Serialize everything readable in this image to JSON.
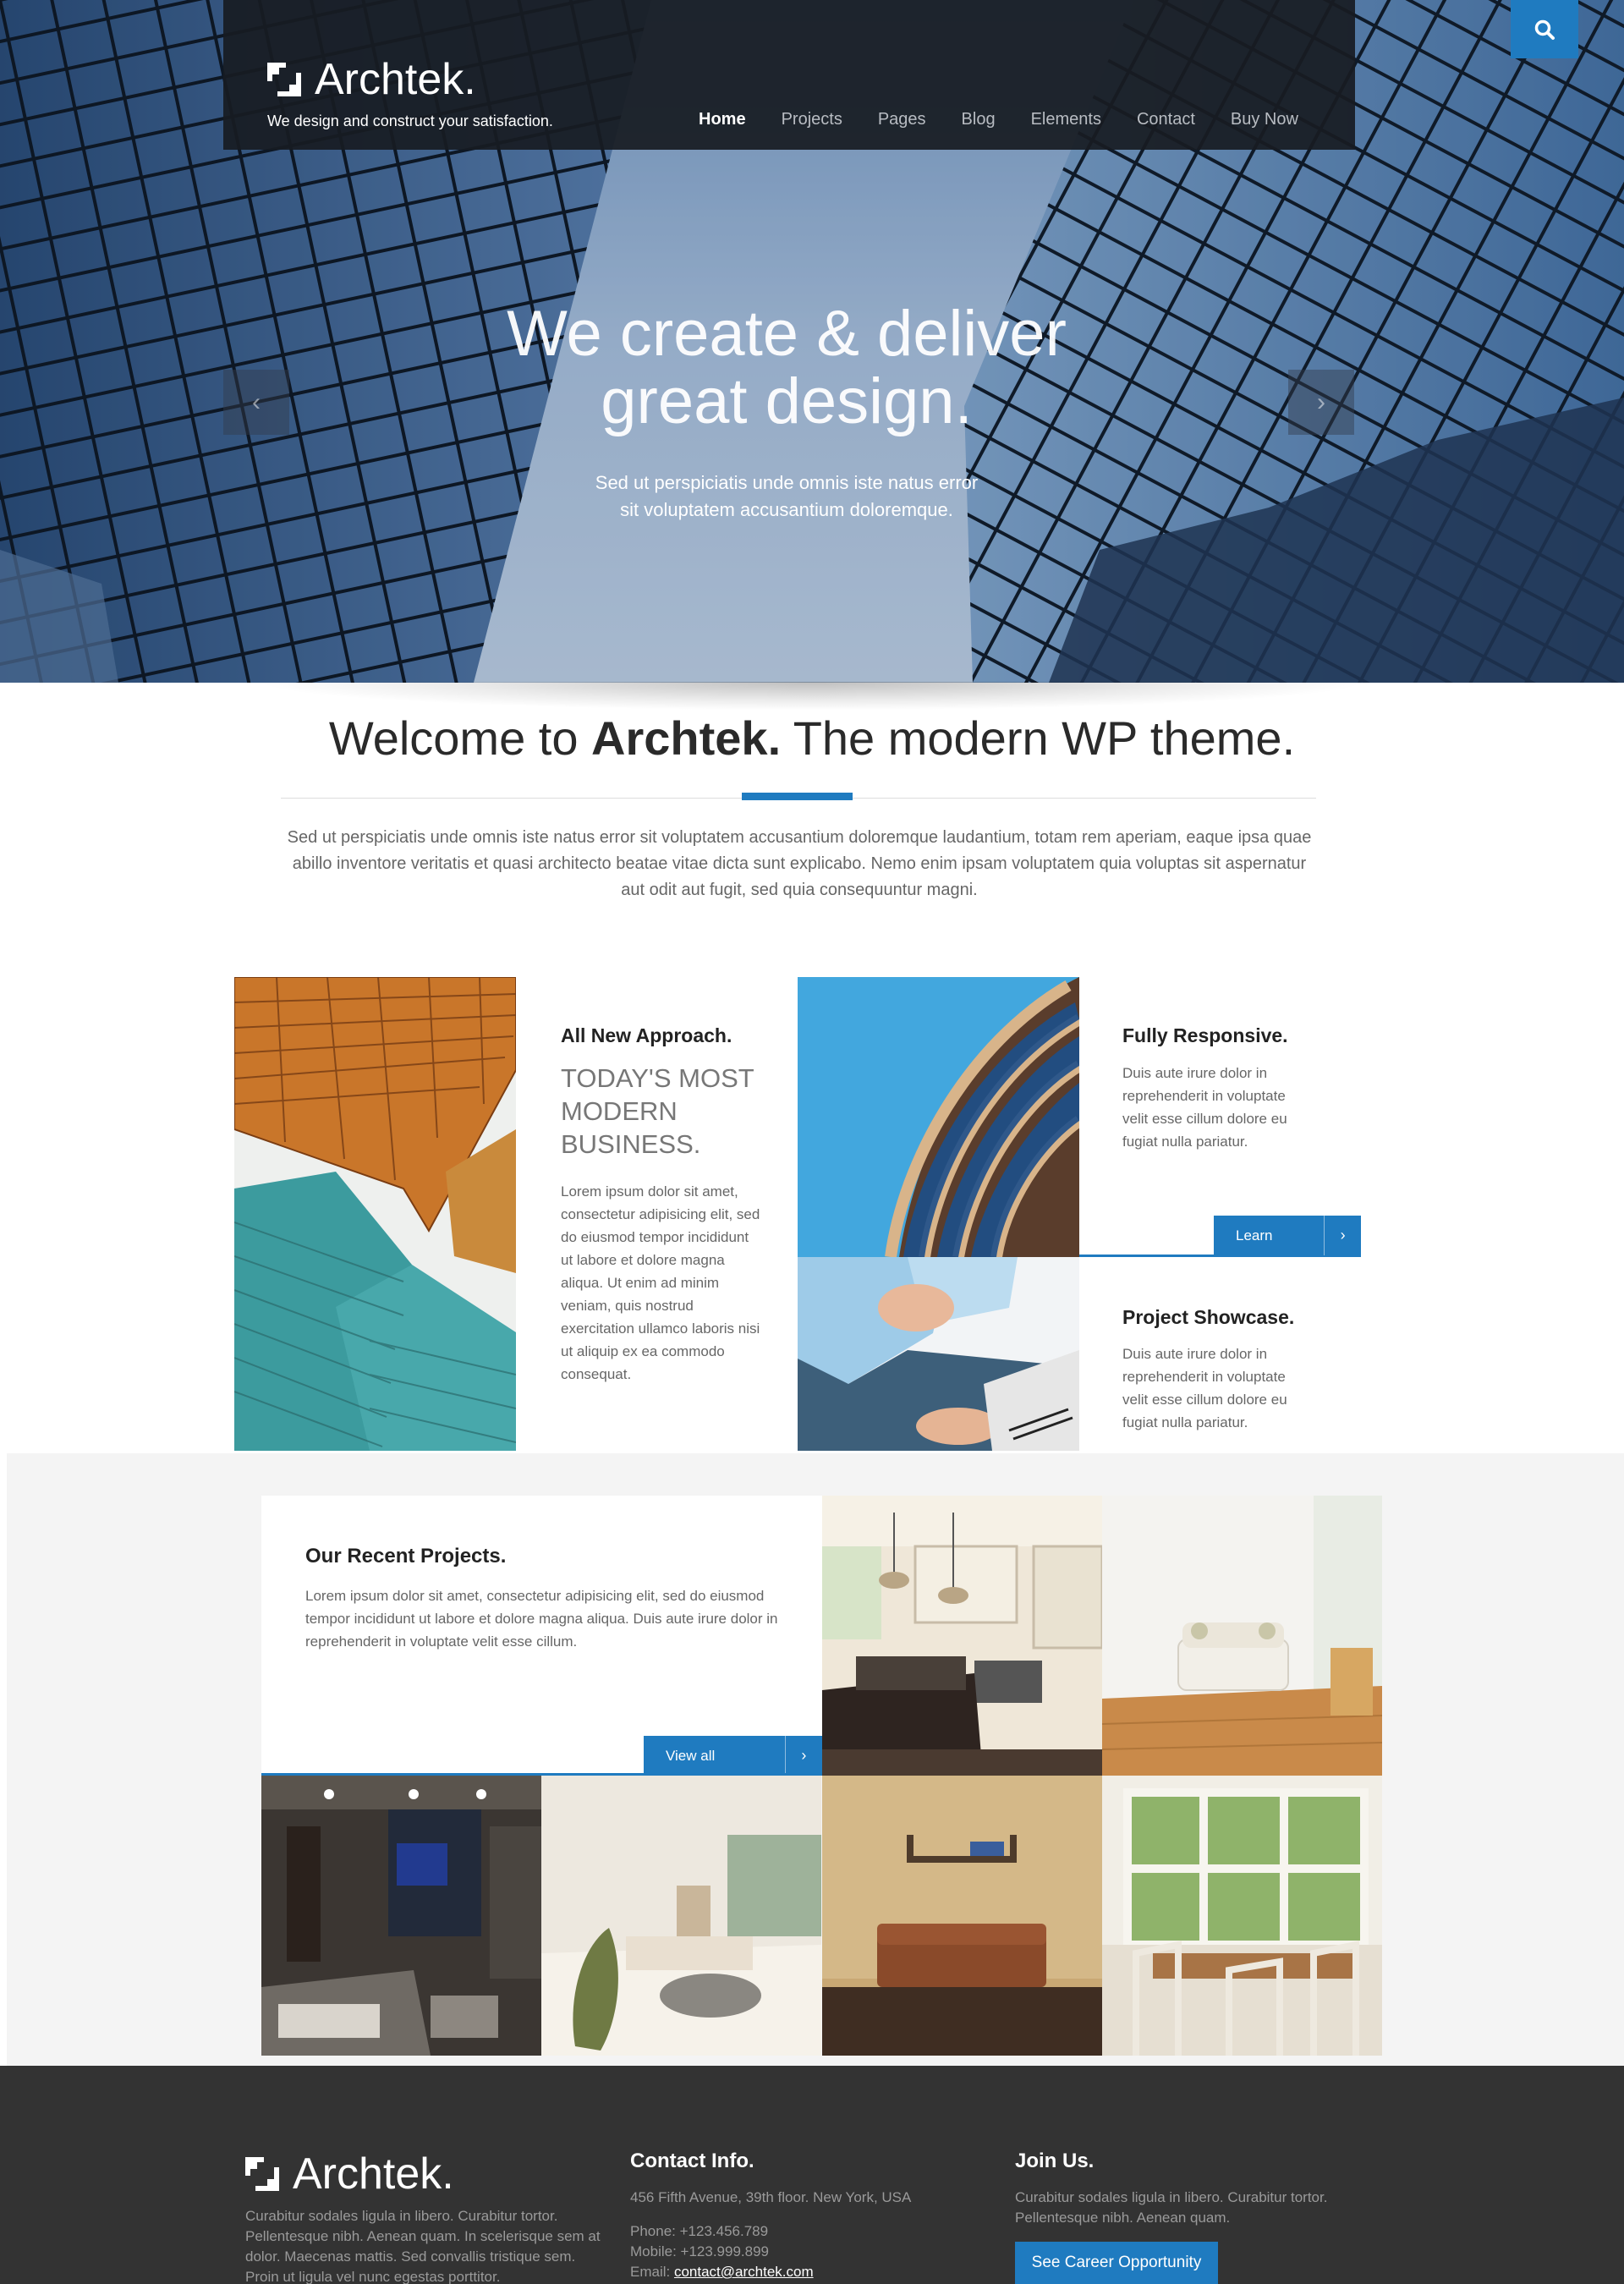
{
  "header": {
    "logo_text": "Archtek.",
    "tagline": "We design and construct your satisfaction.",
    "nav": [
      "Home",
      "Projects",
      "Pages",
      "Blog",
      "Elements",
      "Contact",
      "Buy Now"
    ],
    "active_nav": "Home",
    "search_icon": "search-icon"
  },
  "hero": {
    "title_line1": "We create & deliver",
    "title_line2": "great design.",
    "subtitle_line1": "Sed ut perspiciatis unde omnis iste natus error",
    "subtitle_line2": "sit voluptatem accusantium doloremque.",
    "prev_icon": "chevron-left-icon",
    "next_icon": "chevron-right-icon"
  },
  "welcome": {
    "title_pre": "Welcome to ",
    "title_brand": "Archtek.",
    "title_post": " The modern WP theme.",
    "text": "Sed ut perspiciatis unde omnis iste natus error sit voluptatem accusantium doloremque laudantium, totam rem aperiam, eaque ipsa quae abillo inventore veritatis et quasi architecto beatae vitae dicta sunt explicabo. Nemo enim ipsam voluptatem quia voluptas sit aspernatur aut odit aut fugit, sed quia consequuntur magni."
  },
  "features": {
    "approach": {
      "title": "All New Approach.",
      "big_line1": "TODAY'S MOST",
      "big_line2": "MODERN",
      "big_line3": "BUSINESS.",
      "body": "Lorem ipsum dolor sit amet, consectetur adipisicing elit, sed do eiusmod tempor incididunt ut labore et dolore magna aliqua. Ut enim ad minim veniam, quis nostrud exercitation ullamco laboris nisi ut aliquip ex ea commodo consequat."
    },
    "responsive": {
      "title": "Fully Responsive.",
      "body": "Duis aute irure dolor in reprehenderit in voluptate velit esse cillum dolore eu fugiat nulla pariatur.",
      "button": "Learn more"
    },
    "showcase": {
      "title": "Project Showcase.",
      "body": "Duis aute irure dolor in reprehenderit in voluptate velit esse cillum dolore eu fugiat nulla pariatur."
    }
  },
  "projects": {
    "title": "Our Recent Projects.",
    "text": "Lorem ipsum dolor sit amet, consectetur adipisicing elit, sed do eiusmod tempor incididunt ut labore et dolore magna aliqua. Duis aute irure dolor in reprehenderit in voluptate velit esse cillum.",
    "button": "View all projects"
  },
  "footer": {
    "logo_text": "Archtek.",
    "about": "Curabitur sodales ligula in libero. Curabitur tortor. Pellentesque nibh. Aenean quam. In scelerisque sem at dolor. Maecenas mattis. Sed convallis tristique sem. Proin ut ligula vel nunc egestas porttitor.",
    "contact_title": "Contact Info.",
    "address": "456 Fifth Avenue, 39th floor. New York, USA",
    "phone": "Phone: +123.456.789",
    "mobile": "Mobile: +123.999.899",
    "email_label": "Email: ",
    "email": "contact@archtek.com",
    "join_title": "Join Us.",
    "join_text": "Curabitur sodales ligula in libero. Curabitur tortor. Pellentesque nibh. Aenean quam.",
    "career_button": "See Career Opportunity"
  },
  "colors": {
    "accent": "#1f7bc0",
    "header_bg": "#181c22",
    "footer_bg": "#333333",
    "section_bg": "#f4f4f4"
  }
}
